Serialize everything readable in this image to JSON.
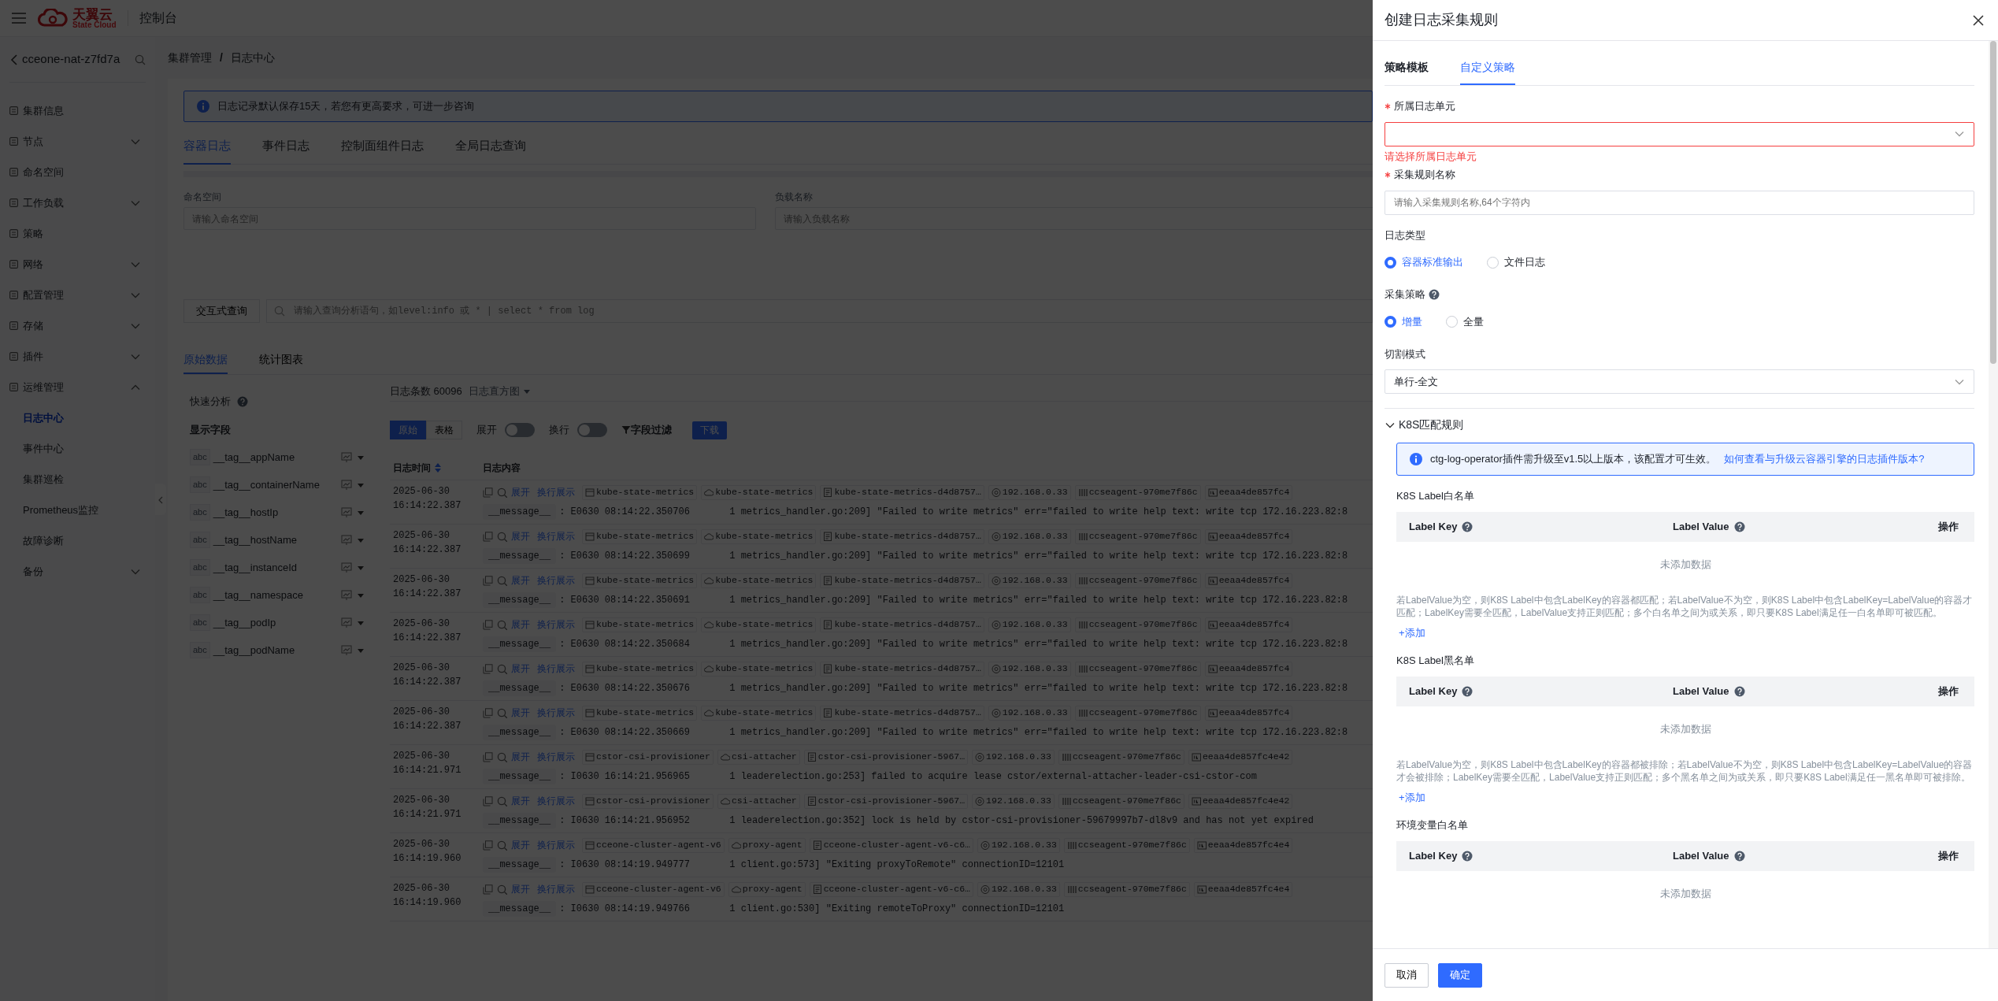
{
  "topbar": {
    "brand": "天翼云",
    "brand_sub": "State Cloud",
    "console": "控制台"
  },
  "sidebar": {
    "cluster": "cceone-nat-z7fd7a",
    "items": [
      {
        "kind": "link",
        "label": "集群信息"
      },
      {
        "kind": "group",
        "label": "节点",
        "expanded": false
      },
      {
        "kind": "link",
        "label": "命名空间"
      },
      {
        "kind": "group",
        "label": "工作负载",
        "expanded": false
      },
      {
        "kind": "link",
        "label": "策略"
      },
      {
        "kind": "group",
        "label": "网络",
        "expanded": false
      },
      {
        "kind": "group",
        "label": "配置管理",
        "expanded": false
      },
      {
        "kind": "group",
        "label": "存储",
        "expanded": false
      },
      {
        "kind": "group",
        "label": "插件",
        "expanded": false
      },
      {
        "kind": "group",
        "label": "运维管理",
        "expanded": true,
        "children": [
          {
            "label": "日志中心",
            "selected": true
          },
          {
            "label": "事件中心",
            "selected": false
          },
          {
            "label": "集群巡检",
            "selected": false
          },
          {
            "label": "Prometheus监控",
            "selected": false
          },
          {
            "label": "故障诊断",
            "selected": false
          }
        ]
      },
      {
        "kind": "group",
        "label": "备份",
        "expanded": false,
        "icon": false
      }
    ]
  },
  "breadcrumb": {
    "items": [
      "集群管理",
      "日志中心"
    ],
    "separator": "/"
  },
  "notice": "日志记录默认保存15天，若您有更高要求，可进一步咨询",
  "log_tabs": [
    {
      "label": "容器日志",
      "selected": true
    },
    {
      "label": "事件日志",
      "selected": false
    },
    {
      "label": "控制面组件日志",
      "selected": false
    },
    {
      "label": "全局日志查询",
      "selected": false
    }
  ],
  "filters": [
    {
      "label": "命名空间",
      "placeholder": "请输入命名空间"
    },
    {
      "label": "负载名称",
      "placeholder": "请输入负载名称"
    }
  ],
  "query": {
    "button": "交互式查询",
    "placeholder": "请输入查询分析语句，如level:info 或 * | select * from log"
  },
  "data_tabs": [
    {
      "label": "原始数据",
      "selected": true
    },
    {
      "label": "统计图表",
      "selected": false
    }
  ],
  "fields_panel": {
    "quick": "快速分析",
    "display": "显示字段",
    "fields": [
      {
        "type": "abc",
        "name": "__tag__appName"
      },
      {
        "type": "abc",
        "name": "__tag__containerName"
      },
      {
        "type": "abc",
        "name": "__tag__hostIp"
      },
      {
        "type": "abc",
        "name": "__tag__hostName"
      },
      {
        "type": "abc",
        "name": "__tag__instanceId"
      },
      {
        "type": "abc",
        "name": "__tag__namespace"
      },
      {
        "type": "abc",
        "name": "__tag__podIp"
      },
      {
        "type": "abc",
        "name": "__tag__podName"
      }
    ]
  },
  "log_panel": {
    "count": "日志条数 60096",
    "histogram": "日志直方图",
    "views": [
      {
        "label": "原始",
        "selected": true
      },
      {
        "label": "表格",
        "selected": false
      }
    ],
    "toggles": [
      {
        "label": "展开",
        "on": false
      },
      {
        "label": "换行",
        "on": false
      }
    ],
    "filter": "字段过滤",
    "download": "下载",
    "columns": [
      "日志时间",
      "日志内容"
    ],
    "rows": [
      {
        "time": "2025-06-30 16:14:22.387",
        "actions": [
          "展开",
          "换行展示"
        ],
        "tags": [
          "kube-state-metrics",
          "kube-state-metrics",
          "kube-state-metrics-d4d8757…",
          "192.168.0.33",
          "ccseagent-970me7f86c",
          "eeaa4de857fc4"
        ],
        "key": "__message__",
        "message": ": E0630 08:14:22.350706       1 metrics_handler.go:209] \"Failed to write metrics\" err=\"failed to write help text: write tcp 172.16.223.82:8"
      },
      {
        "time": "2025-06-30 16:14:22.387",
        "actions": [
          "展开",
          "换行展示"
        ],
        "tags": [
          "kube-state-metrics",
          "kube-state-metrics",
          "kube-state-metrics-d4d8757…",
          "192.168.0.33",
          "ccseagent-970me7f86c",
          "eeaa4de857fc4"
        ],
        "key": "__message__",
        "message": ": E0630 08:14:22.350699       1 metrics_handler.go:209] \"Failed to write metrics\" err=\"failed to write help text: write tcp 172.16.223.82:8"
      },
      {
        "time": "2025-06-30 16:14:22.387",
        "actions": [
          "展开",
          "换行展示"
        ],
        "tags": [
          "kube-state-metrics",
          "kube-state-metrics",
          "kube-state-metrics-d4d8757…",
          "192.168.0.33",
          "ccseagent-970me7f86c",
          "eeaa4de857fc4"
        ],
        "key": "__message__",
        "message": ": E0630 08:14:22.350691       1 metrics_handler.go:209] \"Failed to write metrics\" err=\"failed to write help text: write tcp 172.16.223.82:8"
      },
      {
        "time": "2025-06-30 16:14:22.387",
        "actions": [
          "展开",
          "换行展示"
        ],
        "tags": [
          "kube-state-metrics",
          "kube-state-metrics",
          "kube-state-metrics-d4d8757…",
          "192.168.0.33",
          "ccseagent-970me7f86c",
          "eeaa4de857fc4"
        ],
        "key": "__message__",
        "message": ": E0630 08:14:22.350684       1 metrics_handler.go:209] \"Failed to write metrics\" err=\"failed to write help text: write tcp 172.16.223.82:8"
      },
      {
        "time": "2025-06-30 16:14:22.387",
        "actions": [
          "展开",
          "换行展示"
        ],
        "tags": [
          "kube-state-metrics",
          "kube-state-metrics",
          "kube-state-metrics-d4d8757…",
          "192.168.0.33",
          "ccseagent-970me7f86c",
          "eeaa4de857fc4"
        ],
        "key": "__message__",
        "message": ": E0630 08:14:22.350676       1 metrics_handler.go:209] \"Failed to write metrics\" err=\"failed to write help text: write tcp 172.16.223.82:8"
      },
      {
        "time": "2025-06-30 16:14:22.387",
        "actions": [
          "展开",
          "换行展示"
        ],
        "tags": [
          "kube-state-metrics",
          "kube-state-metrics",
          "kube-state-metrics-d4d8757…",
          "192.168.0.33",
          "ccseagent-970me7f86c",
          "eeaa4de857fc4"
        ],
        "key": "__message__",
        "message": ": E0630 08:14:22.350669       1 metrics_handler.go:209] \"Failed to write metrics\" err=\"failed to write help text: write tcp 172.16.223.82:8"
      },
      {
        "time": "2025-06-30 16:14:21.971",
        "actions": [
          "展开",
          "换行展示"
        ],
        "tags": [
          "cstor-csi-provisioner",
          "csi-attacher",
          "cstor-csi-provisioner-5967…",
          "192.168.0.33",
          "ccseagent-970me7f86c",
          "eeaa4de857fc4e42"
        ],
        "key": "__message__",
        "message": ": I0630 16:14:21.956965       1 leaderelection.go:253] failed to acquire lease cstor/external-attacher-leader-csi-cstor-com"
      },
      {
        "time": "2025-06-30 16:14:21.971",
        "actions": [
          "展开",
          "换行展示"
        ],
        "tags": [
          "cstor-csi-provisioner",
          "csi-attacher",
          "cstor-csi-provisioner-5967…",
          "192.168.0.33",
          "ccseagent-970me7f86c",
          "eeaa4de857fc4e42"
        ],
        "key": "__message__",
        "message": ": I0630 16:14:21.956952       1 leaderelection.go:352] lock is held by cstor-csi-provisioner-59679997b7-dl8v9 and has not yet expired"
      },
      {
        "time": "2025-06-30 16:14:19.960",
        "actions": [
          "展开",
          "换行展示"
        ],
        "tags": [
          "cceone-cluster-agent-v6",
          "proxy-agent",
          "cceone-cluster-agent-v6-c6…",
          "192.168.0.33",
          "ccseagent-970me7f86c",
          "eeaa4de857fc4e4"
        ],
        "key": "__message__",
        "message": ": I0630 08:14:19.949777       1 client.go:573] \"Exiting proxyToRemote\" connectionID=12101"
      },
      {
        "time": "2025-06-30 16:14:19.960",
        "actions": [
          "展开",
          "换行展示"
        ],
        "tags": [
          "cceone-cluster-agent-v6",
          "proxy-agent",
          "cceone-cluster-agent-v6-c6…",
          "192.168.0.33",
          "ccseagent-970me7f86c",
          "eeaa4de857fc4e4"
        ],
        "key": "__message__",
        "message": ": I0630 08:14:19.949766       1 client.go:530] \"Exiting remoteToProxy\" connectionID=12101"
      }
    ]
  },
  "drawer": {
    "title": "创建日志采集规则",
    "tabs": [
      {
        "label": "策略模板",
        "selected": false
      },
      {
        "label": "自定义策略",
        "selected": true
      }
    ],
    "fields": [
      {
        "kind": "select",
        "label": "所属日志单元",
        "required": true,
        "help": false,
        "invalid": true,
        "error": "请选择所属日志单元"
      },
      {
        "kind": "input",
        "label": "采集规则名称",
        "required": true,
        "help": false,
        "placeholder": "请输入采集规则名称,64个字符内"
      },
      {
        "kind": "radio",
        "label": "日志类型",
        "required": false,
        "help": false,
        "options": [
          {
            "label": "容器标准输出",
            "selected": true
          },
          {
            "label": "文件日志",
            "selected": false
          }
        ]
      },
      {
        "kind": "radio",
        "label": "采集策略",
        "required": false,
        "help": true,
        "options": [
          {
            "label": "增量",
            "selected": true
          },
          {
            "label": "全量",
            "selected": false
          }
        ]
      },
      {
        "kind": "select",
        "label": "切割模式",
        "required": false,
        "help": false,
        "invalid": false,
        "value": "单行-全文"
      }
    ],
    "k8s": {
      "title": "K8S匹配规则",
      "expanded": true,
      "notice": "ctg-log-operator插件需升级至v1.5以上版本，该配置才可生效。",
      "notice_link": "如何查看与升级云容器引擎的日志插件版本?",
      "lists": [
        {
          "title": "K8S Label白名单",
          "columns": [
            {
              "label": "Label Key",
              "help": true
            },
            {
              "label": "Label Value",
              "help": true
            },
            {
              "label": "操作",
              "help": false
            }
          ],
          "empty": "未添加数据",
          "note": "若LabelValue为空，则K8S Label中包含LabelKey的容器都匹配；若LabelValue不为空，则K8S Label中包含LabelKey=LabelValue的容器才匹配；LabelKey需要全匹配，LabelValue支持正则匹配；多个白名单之间为或关系，即只要K8S Label满足任一白名单即可被匹配。",
          "add": "+添加"
        },
        {
          "title": "K8S Label黑名单",
          "columns": [
            {
              "label": "Label Key",
              "help": true
            },
            {
              "label": "Label Value",
              "help": true
            },
            {
              "label": "操作",
              "help": false
            }
          ],
          "empty": "未添加数据",
          "note": "若LabelValue为空，则K8S Label中包含LabelKey的容器都被排除；若LabelValue不为空，则K8S Label中包含LabelKey=LabelValue的容器才会被排除；LabelKey需要全匹配，LabelValue支持正则匹配；多个黑名单之间为或关系，即只要K8S Label满足任一黑名单即可被排除。",
          "add": "+添加"
        },
        {
          "title": "环境变量白名单",
          "columns": [
            {
              "label": "Label Key",
              "help": true
            },
            {
              "label": "Label Value",
              "help": true
            },
            {
              "label": "操作",
              "help": false
            }
          ],
          "empty": "未添加数据"
        }
      ]
    },
    "buttons": [
      {
        "label": "取消",
        "kind": "secondary"
      },
      {
        "label": "确定",
        "kind": "primary"
      }
    ]
  }
}
